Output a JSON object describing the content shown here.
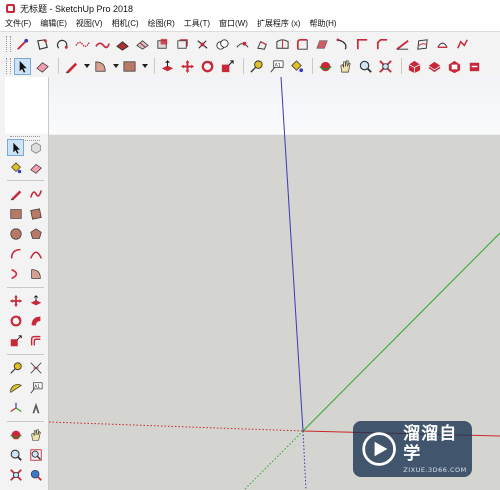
{
  "window": {
    "title": "无标题 - SketchUp Pro 2018"
  },
  "menu": [
    "文件(F)",
    "编辑(E)",
    "视图(V)",
    "相机(C)",
    "绘图(R)",
    "工具(T)",
    "窗口(W)",
    "扩展程序 (x)",
    "帮助(H)"
  ],
  "watermark": {
    "name": "溜溜自学",
    "url": "ZIXUE.3D66.COM"
  },
  "colors": {
    "red_axis": "#c82828",
    "green_axis": "#2ea82e",
    "blue_axis": "#3a3ab8",
    "sky": "#f5f6f8",
    "ground": "#d4d4d0",
    "accent": "#c8283a"
  }
}
